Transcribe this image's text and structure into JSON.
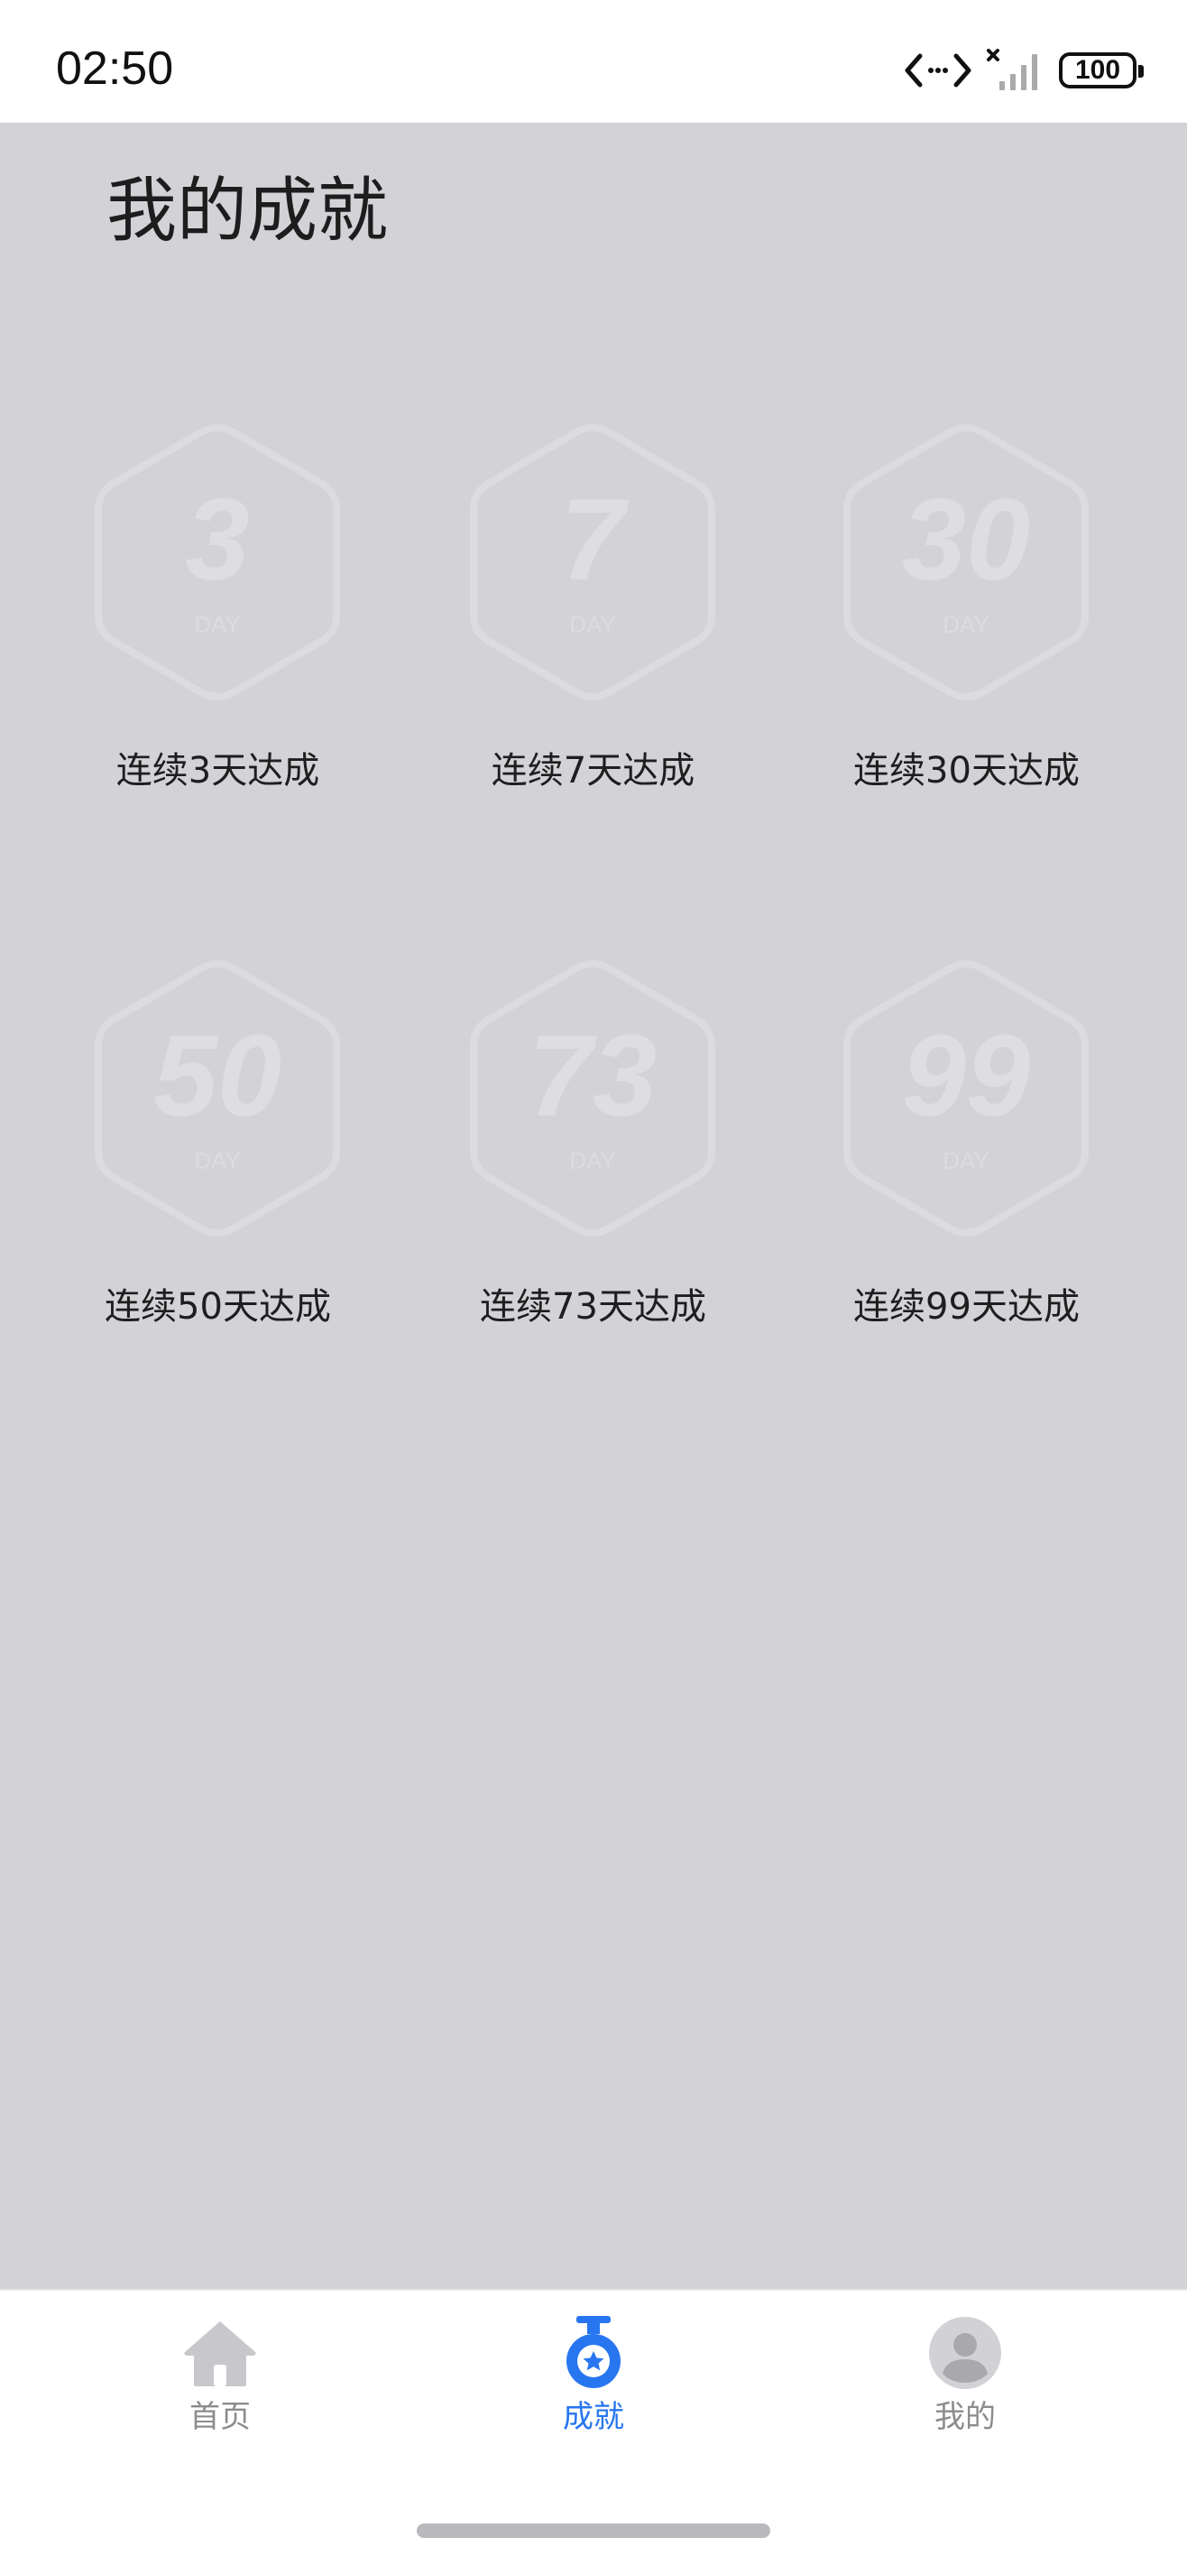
{
  "status_bar": {
    "time": "02:50",
    "battery": "100"
  },
  "page": {
    "title": "我的成就"
  },
  "badges": [
    {
      "number": "3",
      "unit": "DAY",
      "label": "连续3天达成"
    },
    {
      "number": "7",
      "unit": "DAY",
      "label": "连续7天达成"
    },
    {
      "number": "30",
      "unit": "DAY",
      "label": "连续30天达成"
    },
    {
      "number": "50",
      "unit": "DAY",
      "label": "连续50天达成"
    },
    {
      "number": "73",
      "unit": "DAY",
      "label": "连续73天达成"
    },
    {
      "number": "99",
      "unit": "DAY",
      "label": "连续99天达成"
    }
  ],
  "tab_bar": {
    "items": [
      {
        "label": "首页",
        "icon": "home-icon",
        "active": false
      },
      {
        "label": "成就",
        "icon": "medal-icon",
        "active": true
      },
      {
        "label": "我的",
        "icon": "profile-icon",
        "active": false
      }
    ],
    "active_color": "#2776f0",
    "inactive_color": "#8c8c8c"
  },
  "colors": {
    "background": "#d3d2d7",
    "badge_outline": "#dcdbe0",
    "badge_text": "#dedde2"
  }
}
